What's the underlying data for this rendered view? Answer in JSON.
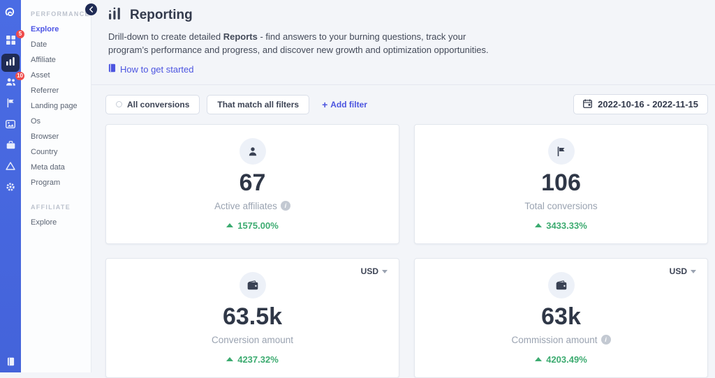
{
  "colors": {
    "rail_blue": "#4667dd",
    "active_navy": "#1f2b55",
    "link_indigo": "#4c55e0",
    "positive_green": "#3cab70",
    "badge_red": "#ef4b4b",
    "main_background": "#f3f5f9"
  },
  "rail": {
    "dashboard_badge": "5",
    "affiliates_badge": "10"
  },
  "sidebar": {
    "performance_header": "PERFORMANCE",
    "performance_items": [
      "Explore",
      "Date",
      "Affiliate",
      "Asset",
      "Referrer",
      "Landing page",
      "Os",
      "Browser",
      "Country",
      "Meta data",
      "Program"
    ],
    "affiliate_header": "AFFILIATE",
    "affiliate_items": [
      "Explore"
    ]
  },
  "header": {
    "title": "Reporting",
    "description_prefix": "Drill-down to create detailed ",
    "description_bold": "Reports",
    "description_suffix": " - find answers to your burning questions, track your program’s performance and progress, and discover new growth and optimization opportunities.",
    "link_label": "How to get started"
  },
  "filters": {
    "scope_button": "All conversions",
    "match_button": "That match all filters",
    "plus_glyph": "+",
    "add_filter_label": "Add filter",
    "date_range": "2022-10-16 - 2022-11-15"
  },
  "cards": [
    {
      "value": "67",
      "label": "Active affiliates",
      "change": "1575.00%"
    },
    {
      "value": "106",
      "label": "Total conversions",
      "change": "3433.33%"
    },
    {
      "value": "63.5k",
      "label": "Conversion amount",
      "change": "4237.32%",
      "currency": "USD"
    },
    {
      "value": "63k",
      "label": "Commission amount",
      "change": "4203.49%",
      "currency": "USD"
    }
  ]
}
